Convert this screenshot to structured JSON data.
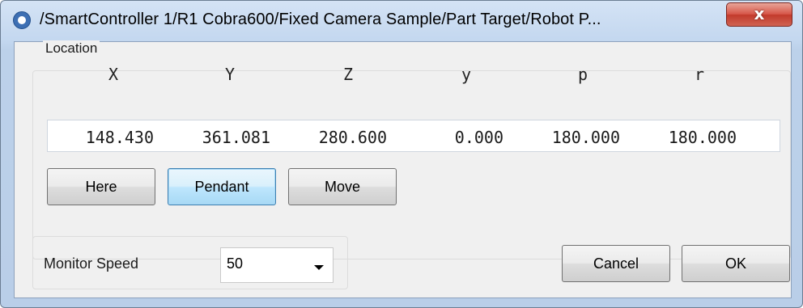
{
  "window": {
    "title": "/SmartController 1/R1 Cobra600/Fixed Camera Sample/Part Target/Robot P...",
    "close_label": "x"
  },
  "location": {
    "group_label": "Location",
    "columns": [
      "X",
      "Y",
      "Z",
      "y",
      "p",
      "r"
    ],
    "values": [
      "148.430",
      "361.081",
      "280.600",
      "0.000",
      "180.000",
      "180.000"
    ],
    "buttons": {
      "here": "Here",
      "pendant": "Pendant",
      "move": "Move"
    }
  },
  "monitor_speed": {
    "label": "Monitor Speed",
    "value": "50"
  },
  "footer": {
    "cancel": "Cancel",
    "ok": "OK"
  },
  "colors": {
    "title_bar": "#c3d7ef",
    "close_button": "#d7574a",
    "focus_border": "#3c7fb1"
  },
  "icons": {
    "app": "circle-logo-icon",
    "close": "close-icon",
    "dropdown": "chevron-down-icon"
  }
}
